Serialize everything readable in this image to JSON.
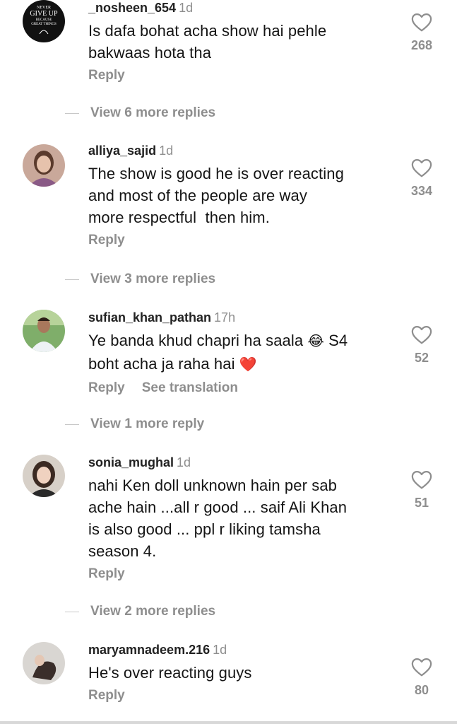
{
  "comments": [
    {
      "username": "_nosheen_654",
      "time": "1d",
      "text": "Is dafa bohat acha show hai pehle\nbakwaas hota tha",
      "likes": "268",
      "reply": "Reply",
      "avatar_text": {
        "l1": "NEVER",
        "l2": "GIVE UP",
        "l3": "BECAUSE",
        "l4": "GREAT THINGS"
      },
      "view_more": "View 6 more replies"
    },
    {
      "username": "alliya_sajid",
      "time": "1d",
      "text": "The show is good he is over reacting\nand most of the people are way\nmore respectful  then him.",
      "likes": "334",
      "reply": "Reply",
      "view_more": "View 3 more replies"
    },
    {
      "username": "sufian_khan_pathan",
      "time": "17h",
      "text_part1": "Ye banda khud chapri ha saala ",
      "emoji1": "😂",
      "text_part2": " S4",
      "text_line2": "boht acha ja raha hai ",
      "emoji2": "❤️",
      "likes": "52",
      "reply": "Reply",
      "see_translation": "See translation",
      "view_more": "View 1 more reply"
    },
    {
      "username": "sonia_mughal",
      "time": "1d",
      "text": "nahi Ken doll unknown hain per sab\nache hain ...all r good ... saif Ali Khan\nis also good ... ppl r liking tamsha\nseason 4.",
      "likes": "51",
      "reply": "Reply",
      "view_more": "View 2 more replies"
    },
    {
      "username": "maryamnadeem.216",
      "time": "1d",
      "text": "He's over reacting guys",
      "likes": "80",
      "reply": "Reply"
    }
  ],
  "icons": {
    "like": "heart-outline-icon"
  },
  "colors": {
    "muted": "#8e8e8e",
    "text": "#151515"
  }
}
